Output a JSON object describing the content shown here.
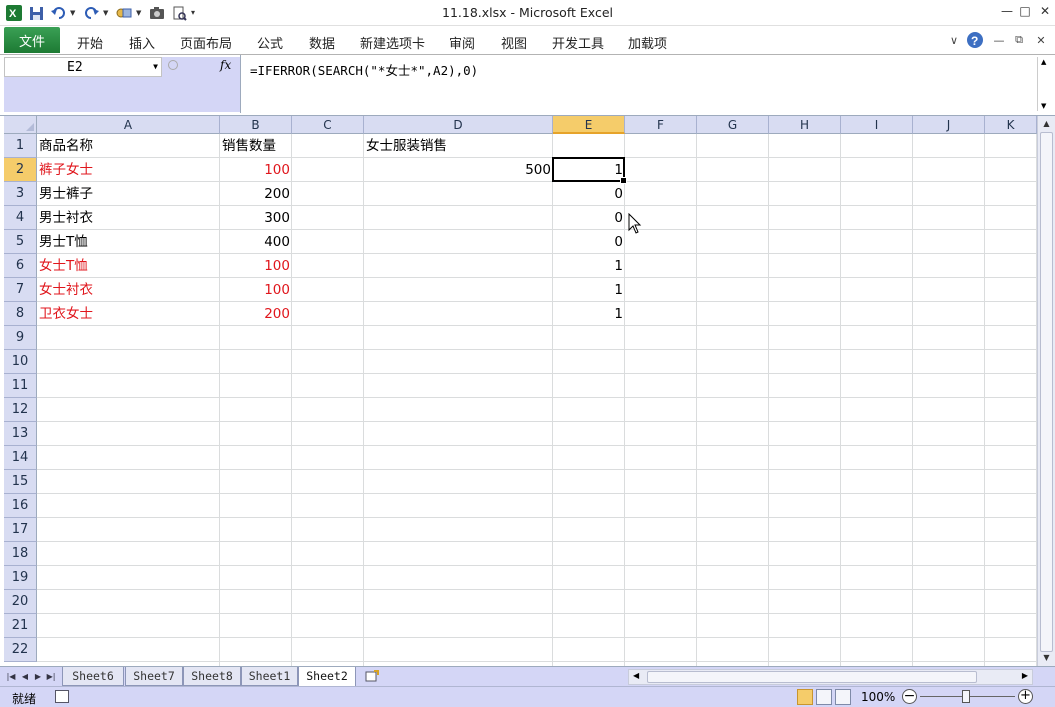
{
  "window": {
    "title": "11.18.xlsx  -  Microsoft Excel"
  },
  "ribbon": {
    "file_label": "文件",
    "tabs": [
      "开始",
      "插入",
      "页面布局",
      "公式",
      "数据",
      "新建选项卡",
      "审阅",
      "视图",
      "开发工具",
      "加载项"
    ]
  },
  "formula_bar": {
    "name_box": "E2",
    "fx_label": "fx",
    "formula": "=IFERROR(SEARCH(\"*女士*\",A2),0)"
  },
  "grid": {
    "columns": [
      "A",
      "B",
      "C",
      "D",
      "E",
      "F",
      "G",
      "H",
      "I",
      "J",
      "K"
    ],
    "rows": [
      "1",
      "2",
      "3",
      "4",
      "5",
      "6",
      "7",
      "8",
      "9",
      "10",
      "11",
      "12",
      "13",
      "14",
      "15",
      "16",
      "17",
      "18",
      "19",
      "20",
      "21",
      "22"
    ],
    "selected_column": "E",
    "selected_row": "2",
    "header_row": {
      "a": "商品名称",
      "b": "销售数量",
      "d": "女士服装销售"
    },
    "data_rows": [
      {
        "a": "裤子女士",
        "b": "100",
        "d": "500",
        "e": "1",
        "highlight": true
      },
      {
        "a": "男士裤子",
        "b": "200",
        "d": "",
        "e": "0",
        "highlight": false
      },
      {
        "a": "男士衬衣",
        "b": "300",
        "d": "",
        "e": "0",
        "highlight": false
      },
      {
        "a": "男士T恤",
        "b": "400",
        "d": "",
        "e": "0",
        "highlight": false
      },
      {
        "a": "女士T恤",
        "b": "100",
        "d": "",
        "e": "1",
        "highlight": true
      },
      {
        "a": "女士衬衣",
        "b": "100",
        "d": "",
        "e": "1",
        "highlight": true
      },
      {
        "a": "卫衣女士",
        "b": "200",
        "d": "",
        "e": "1",
        "highlight": true
      }
    ],
    "highlight_color": "#e0161c"
  },
  "sheets": {
    "tabs": [
      "Sheet6",
      "Sheet7",
      "Sheet8",
      "Sheet1",
      "Sheet2"
    ],
    "active": "Sheet2"
  },
  "status": {
    "text": "就绪",
    "zoom": "100%"
  },
  "colors": {
    "file_tab": "#2a8a3f",
    "selected_header": "#f5cc6a",
    "chrome": "#d4d6f6"
  }
}
